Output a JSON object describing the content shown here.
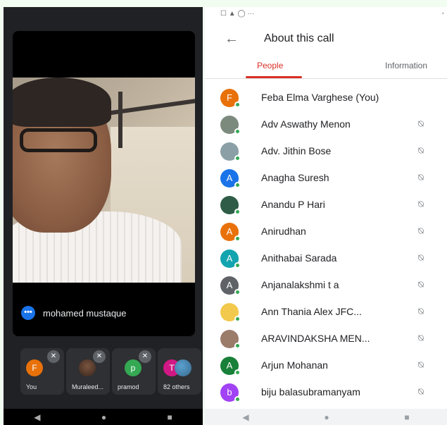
{
  "left": {
    "video_participant_name": "mohamed mustaque",
    "tiles": [
      {
        "label": "You",
        "initial": "F"
      },
      {
        "label": "Muraleed...",
        "initial": ""
      },
      {
        "label": "pramod",
        "initial": "p"
      },
      {
        "label": "82 others",
        "initial": "T"
      }
    ]
  },
  "right": {
    "title": "About this call",
    "tabs": [
      {
        "label": "People"
      },
      {
        "label": "Information"
      }
    ],
    "people": [
      {
        "name": "Feba Elma Varghese (You)",
        "initial": "F",
        "color": "#e8710a",
        "muted": false
      },
      {
        "name": "Adv Aswathy Menon",
        "initial": "",
        "color": "#7c8a7e",
        "muted": true
      },
      {
        "name": "Adv. Jithin Bose",
        "initial": "",
        "color": "#8aa0a6",
        "muted": true
      },
      {
        "name": "Anagha Suresh",
        "initial": "A",
        "color": "#1a73e8",
        "muted": true
      },
      {
        "name": "Anandu P Hari",
        "initial": "",
        "color": "#2e5c46",
        "muted": true
      },
      {
        "name": "Anirudhan",
        "initial": "A",
        "color": "#e8710a",
        "muted": true
      },
      {
        "name": "Anithabai Sarada",
        "initial": "A",
        "color": "#12a4af",
        "muted": true
      },
      {
        "name": "Anjanalakshmi t a",
        "initial": "A",
        "color": "#5f6368",
        "muted": true
      },
      {
        "name": "Ann Thania Alex JFC...",
        "initial": "",
        "color": "#f2c94c",
        "muted": true
      },
      {
        "name": "ARAVINDAKSHA MEN...",
        "initial": "",
        "color": "#9b7b6a",
        "muted": true
      },
      {
        "name": "Arjun Mohanan",
        "initial": "A",
        "color": "#188038",
        "muted": true
      },
      {
        "name": "biju balasubramanyam",
        "initial": "b",
        "color": "#a142f4",
        "muted": true
      }
    ]
  }
}
